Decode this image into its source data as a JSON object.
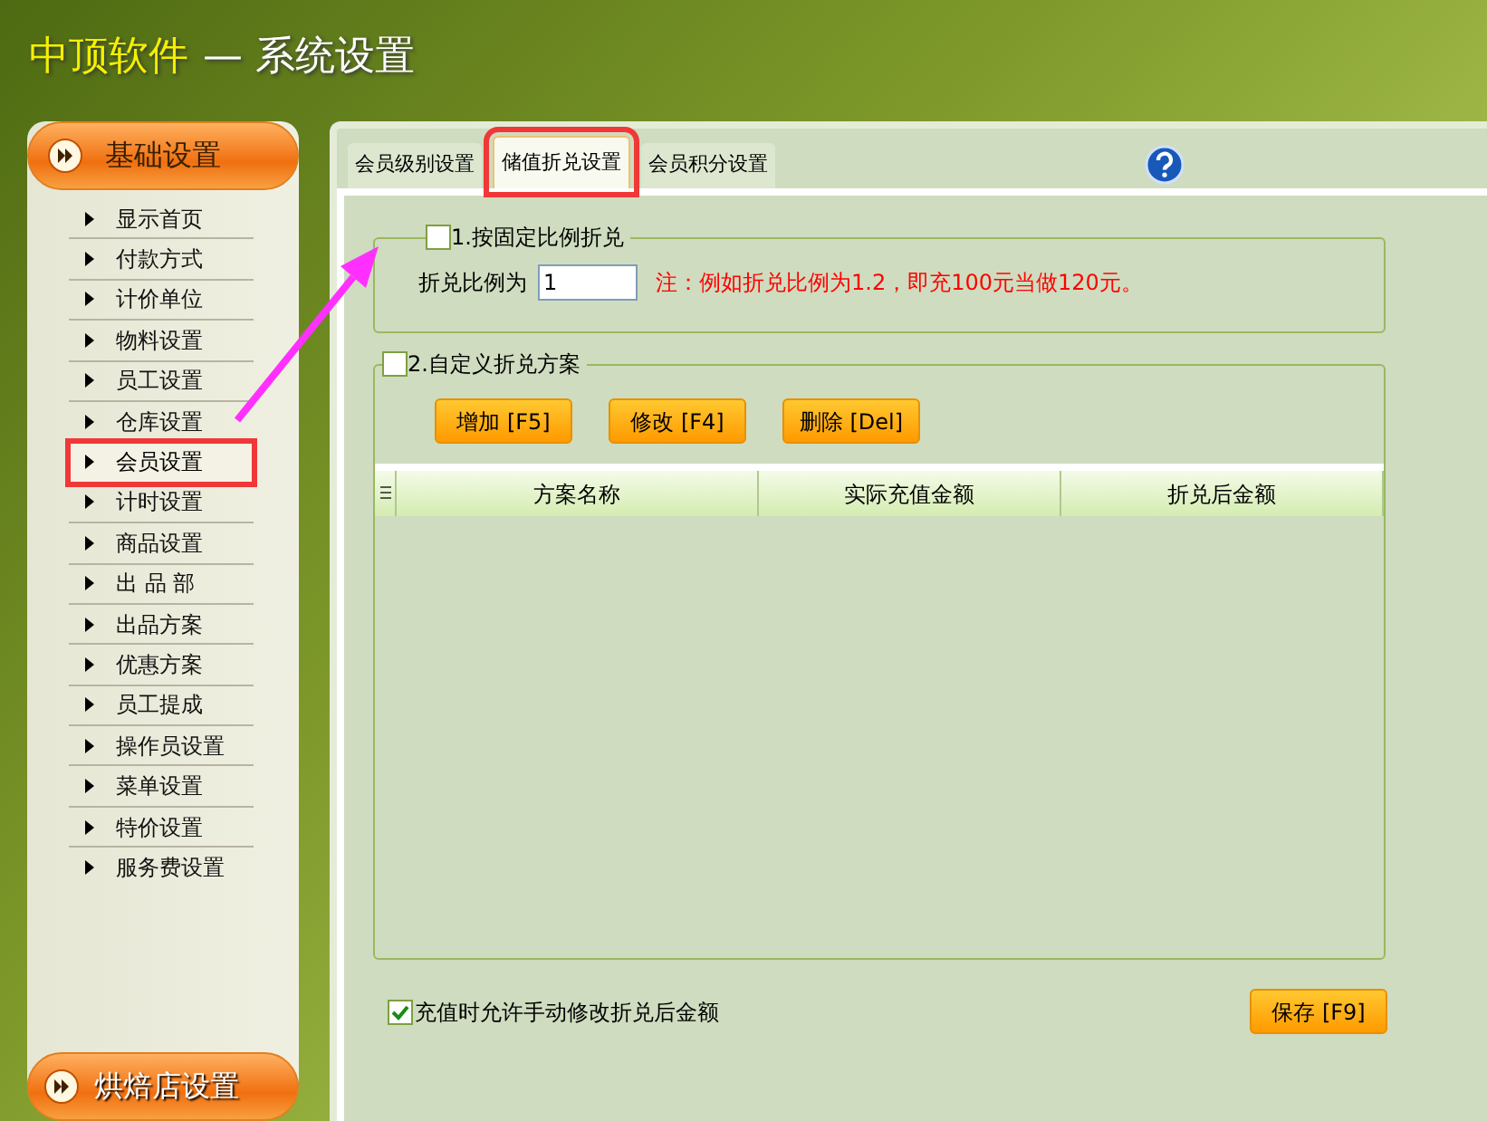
{
  "window": {
    "title_brand": "中顶软件",
    "title_rest": "— 系统设置"
  },
  "sidebar": {
    "header": "基础设置",
    "items": [
      {
        "label": "显示首页",
        "selected": false
      },
      {
        "label": "付款方式",
        "selected": false
      },
      {
        "label": "计价单位",
        "selected": false
      },
      {
        "label": "物料设置",
        "selected": false
      },
      {
        "label": "员工设置",
        "selected": false
      },
      {
        "label": "仓库设置",
        "selected": false
      },
      {
        "label": "会员设置",
        "selected": true
      },
      {
        "label": "计时设置",
        "selected": false
      },
      {
        "label": "商品设置",
        "selected": false
      },
      {
        "label": "出 品 部",
        "selected": false
      },
      {
        "label": "出品方案",
        "selected": false
      },
      {
        "label": "优惠方案",
        "selected": false
      },
      {
        "label": "员工提成",
        "selected": false
      },
      {
        "label": "操作员设置",
        "selected": false
      },
      {
        "label": "菜单设置",
        "selected": false
      },
      {
        "label": "特价设置",
        "selected": false
      },
      {
        "label": "服务费设置",
        "selected": false
      }
    ],
    "footer": "烘焙店设置"
  },
  "tabs": [
    {
      "label": "会员级别设置",
      "selected": false
    },
    {
      "label": "储值折兑设置",
      "selected": true
    },
    {
      "label": "会员积分设置",
      "selected": false
    }
  ],
  "fixed_ratio": {
    "title": "1.按固定比例折兑",
    "checked": false,
    "label": "折兑比例为",
    "value": "1",
    "note": "注：例如折兑比例为1.2，即充100元当做120元。"
  },
  "custom_plan": {
    "title": "2.自定义折兑方案",
    "checked": false,
    "buttons": [
      "增加 [F5]",
      "修改 [F4]",
      "删除 [Del]"
    ],
    "table": {
      "columns": [
        "方案名称",
        "实际充值金额",
        "折兑后金额"
      ]
    }
  },
  "allow_manual": {
    "label": "充值时允许手动修改折兑后金额",
    "checked": true
  },
  "save_button": "保存 [F9]"
}
